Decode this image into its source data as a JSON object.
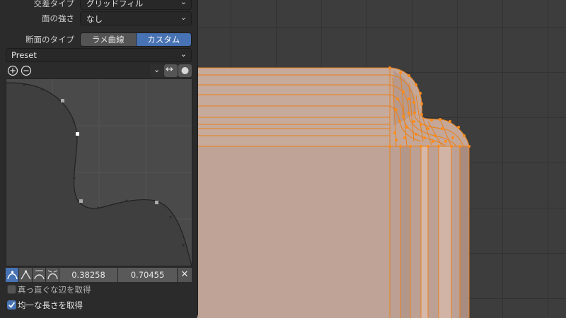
{
  "panel": {
    "crossing_type": {
      "label": "交差タイプ",
      "value": "グリッドフィル"
    },
    "face_strength": {
      "label": "面の強さ",
      "value": "なし"
    },
    "profile_type": {
      "label": "断面のタイプ",
      "options": [
        "ラメ曲線",
        "カスタム"
      ],
      "selected": "カスタム"
    },
    "preset": {
      "value": "Preset"
    },
    "curve_values": {
      "x": "0.38258",
      "y": "0.70455"
    },
    "checkbox_straight_edges": {
      "label": "真っ直ぐな辺を取得",
      "checked": false
    },
    "checkbox_even_length": {
      "label": "均一な長さを取得",
      "checked": true
    }
  },
  "icons": [
    "zoom-in-icon",
    "zoom-out-icon",
    "chevron-down-icon",
    "swap-horizontal-icon",
    "dot-icon",
    "handle-auto-icon",
    "handle-vector-icon",
    "handle-auto-clamped-icon",
    "handle-free-icon",
    "close-icon"
  ],
  "colors": {
    "accent": "#4772b3",
    "mesh_edge": "#e8801a",
    "mesh_face": "#c7a595",
    "panel": "#2b2b2b"
  }
}
